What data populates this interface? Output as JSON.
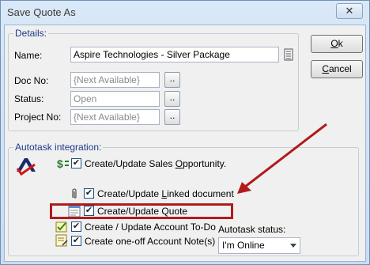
{
  "window": {
    "title": "Save Quote As",
    "close_glyph": "✕"
  },
  "details": {
    "legend": "Details:",
    "name_label": "Name:",
    "name_value": "Aspire Technologies - Silver Package",
    "doc_label": "Doc No:",
    "doc_value": "{Next Available}",
    "status_label": "Status:",
    "status_value": "Open",
    "project_label": "Project No:",
    "project_value": "{Next Available}",
    "browse_label": ".."
  },
  "buttons": {
    "ok_pre": "",
    "ok_key": "O",
    "ok_post": "k",
    "cancel_pre": "",
    "cancel_key": "C",
    "cancel_post": "ancel"
  },
  "autotask": {
    "legend": "Autotask integration:",
    "opportunity_pre": "Create/Update Sales ",
    "opportunity_key": "O",
    "opportunity_post": "pportunity.",
    "linked_pre": "Create/Update ",
    "linked_key": "L",
    "linked_post": "inked document",
    "quote_label": "Create/Update Quote",
    "todo_label": "Create / Update Account To-Do",
    "note_label": "Create one-off Account Note(s)",
    "status_label": "Autotask status:",
    "status_value": "I'm Online",
    "checkbox_glyph": "✔"
  },
  "colors": {
    "highlight": "#b11b1b",
    "arrow": "#b11b1b",
    "logo": "#1b2a6b",
    "logo_check": "#d01818"
  },
  "icons": [
    "close-icon",
    "edit-icon",
    "autotask-logo-icon",
    "dollar-icon",
    "paperclip-icon",
    "quote-document-icon",
    "todo-icon",
    "note-icon",
    "chevron-down-icon"
  ]
}
